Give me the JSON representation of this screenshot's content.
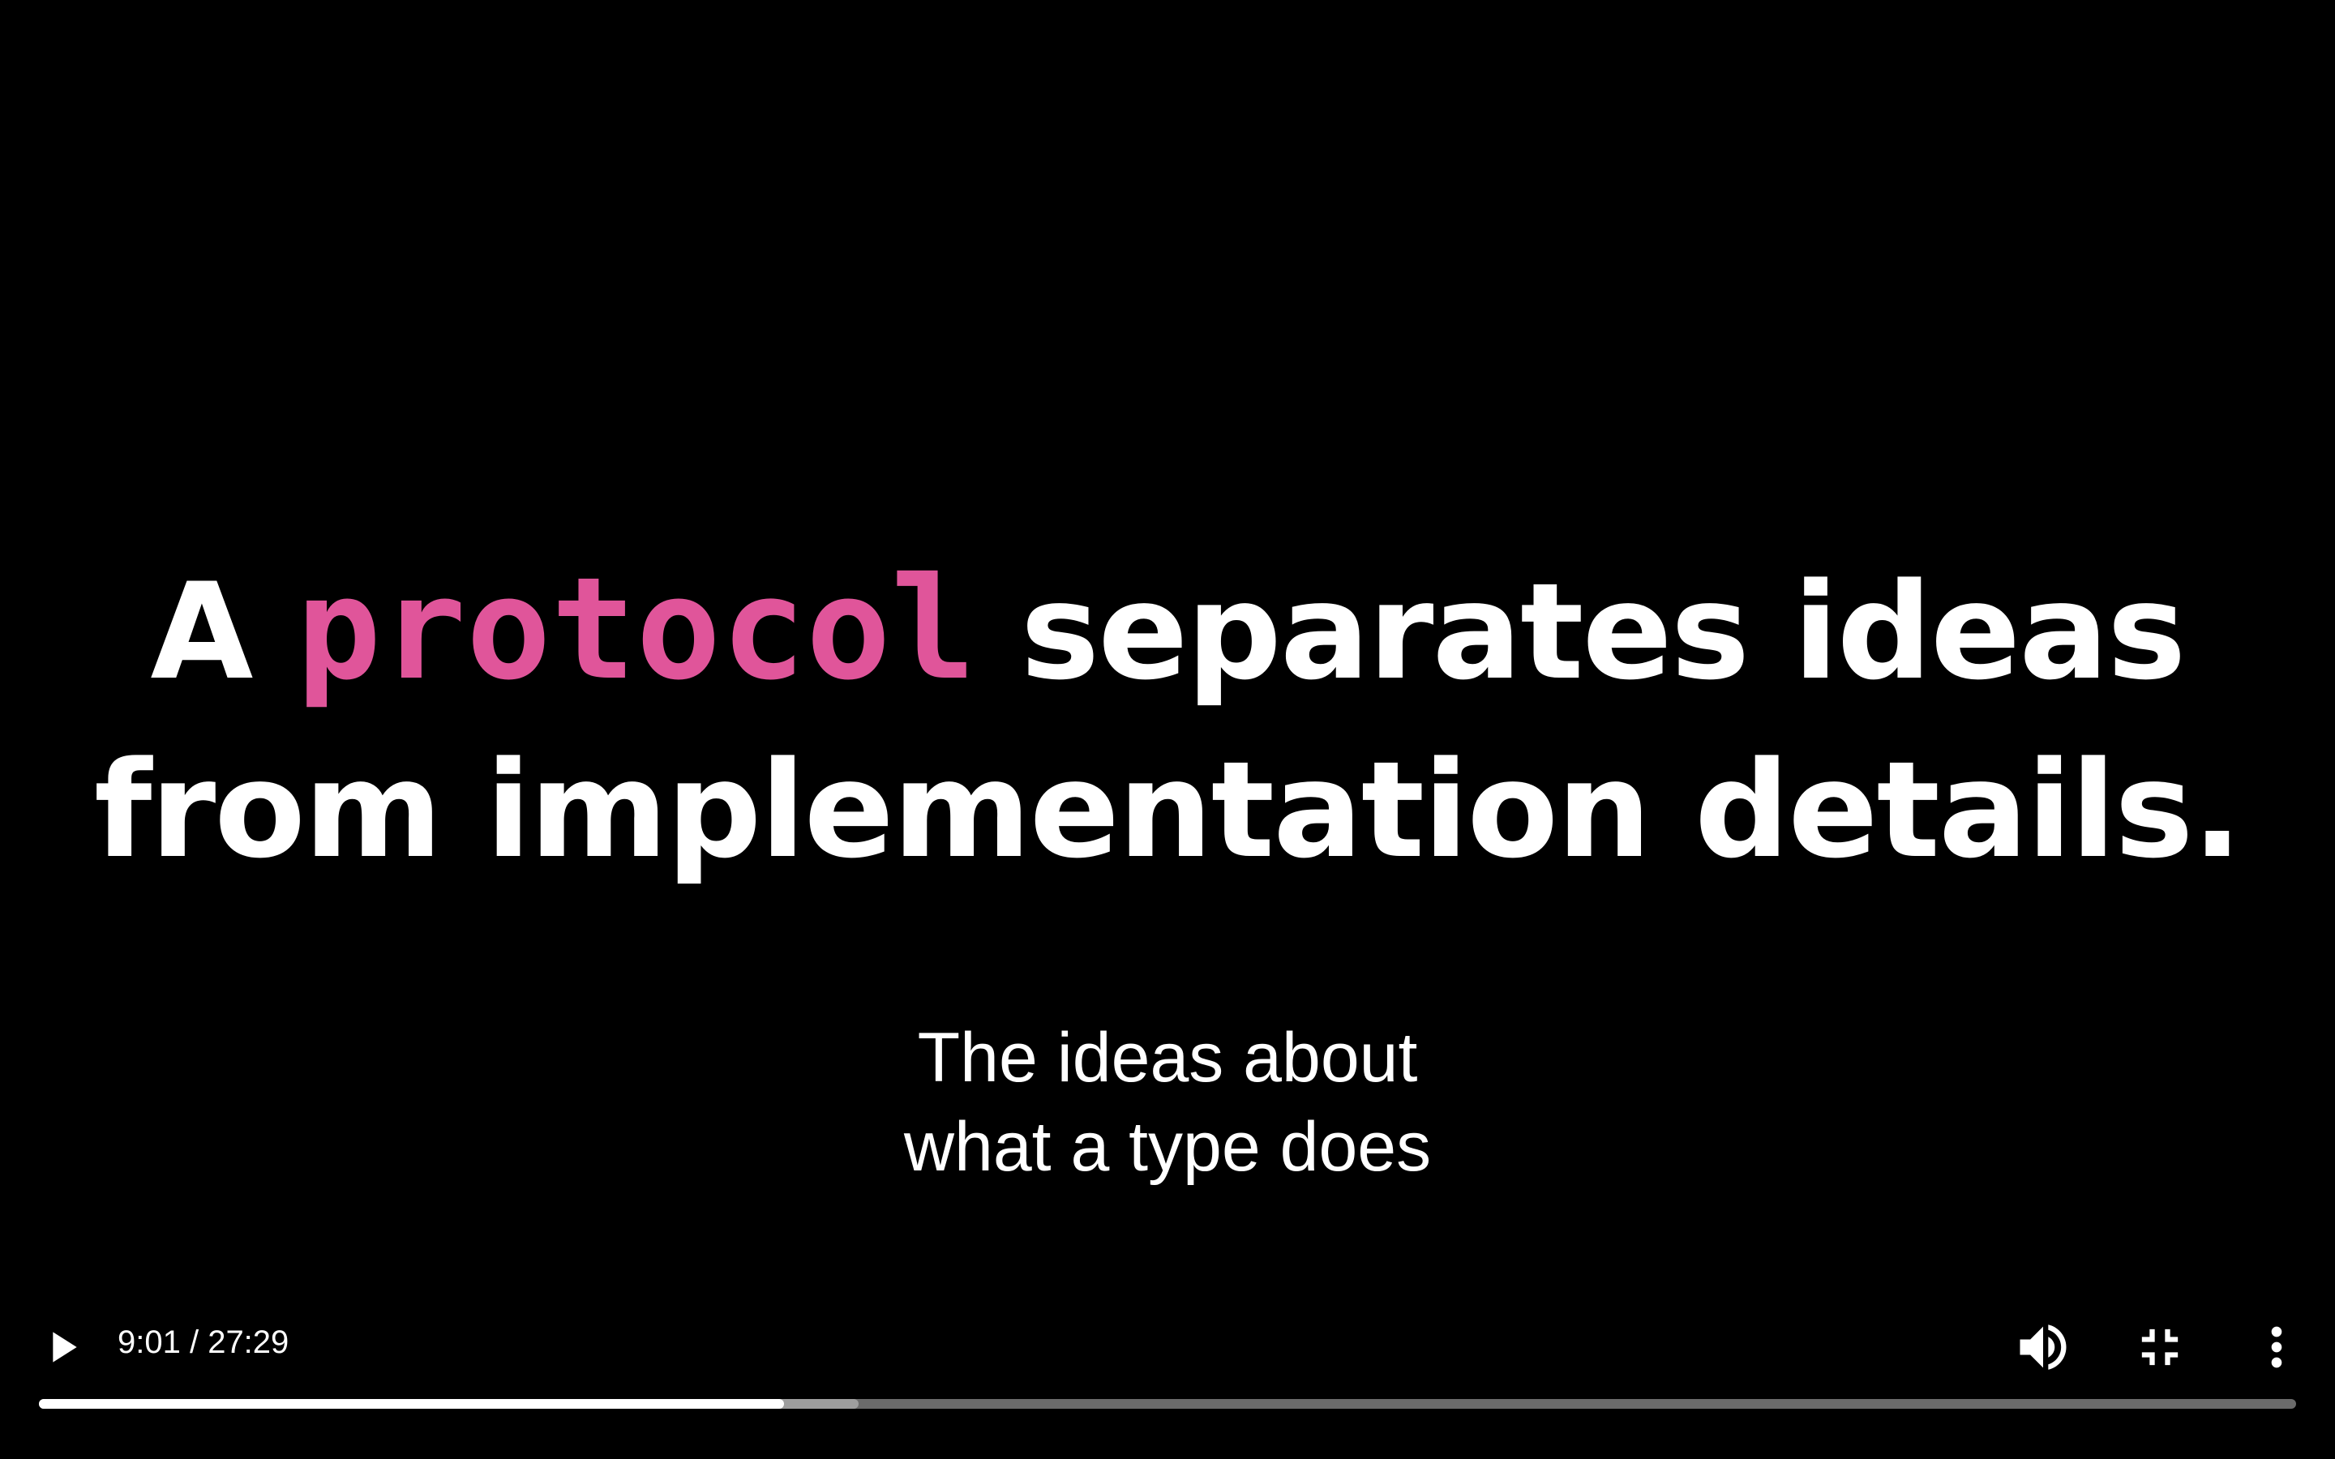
{
  "slide": {
    "line1_prefix": "A ",
    "keyword": "protocol",
    "line1_suffix": " separates ideas",
    "line2": "from implementation details.",
    "keyword_color": "#e0559a"
  },
  "captions": {
    "line1": "The ideas about",
    "line2": "what a type does"
  },
  "controls": {
    "play_icon": "play-icon",
    "time": "9:01 / 27:29",
    "current_time": "9:01",
    "duration": "27:29",
    "played_fraction": 0.33,
    "buffered_fraction": 0.363,
    "volume_icon": "volume-up-icon",
    "fullscreen_icon": "fullscreen-exit-icon",
    "more_icon": "more-vert-icon"
  }
}
